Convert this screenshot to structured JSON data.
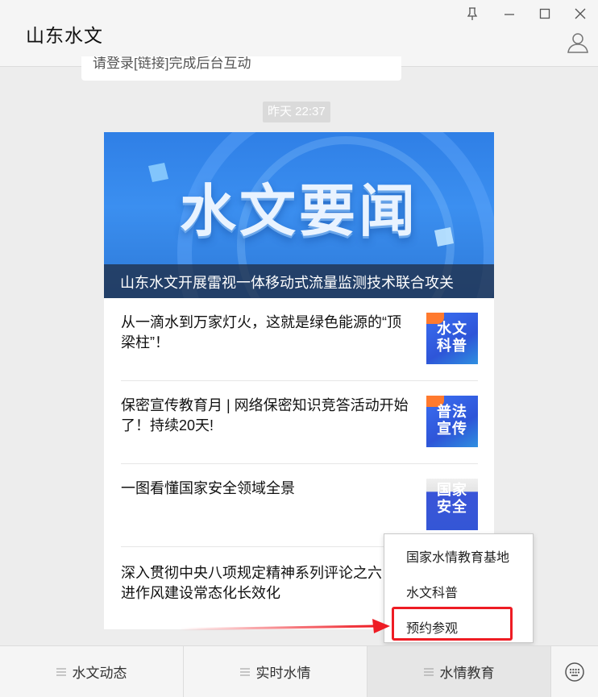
{
  "window": {
    "title": "山东水文",
    "controls": [
      "pin-icon",
      "minimize-icon",
      "maximize-icon",
      "close-icon"
    ],
    "profile_icon": "user-icon"
  },
  "chat": {
    "previous_card_text": "请登录[链接]完成后台互动",
    "timestamp": "昨天 22:37",
    "article": {
      "banner_word": "水文要闻",
      "headline": "山东水文开展雷视一体移动式流量监测技术联合攻关",
      "items": [
        {
          "title": "从一滴水到万家灯火，这就是绿色能源的“顶梁柱”！",
          "thumb_text": "水文科普"
        },
        {
          "title": "保密宣传教育月 | 网络保密知识竞答活动开始了！持续20天!",
          "thumb_text": "普法宣传"
        },
        {
          "title": "一图看懂国家安全领域全景",
          "thumb_text": "国家安全"
        },
        {
          "title": "深入贯彻中央八项规定精神系列评论之六 | 推进作风建设常态化长效化"
        }
      ]
    }
  },
  "popup_menu": {
    "items": [
      "国家水情教育基地",
      "水文科普",
      "预约参观"
    ],
    "highlighted": "预约参观"
  },
  "bottom_menu": {
    "tabs": [
      "水文动态",
      "实时水情",
      "水情教育"
    ],
    "active": "水情教育",
    "keyboard_icon": "keyboard-icon"
  },
  "colors": {
    "highlight": "#ee1c24",
    "banner_blue": "#2f7fe6",
    "thumb_orange": "#ff7a2e"
  }
}
